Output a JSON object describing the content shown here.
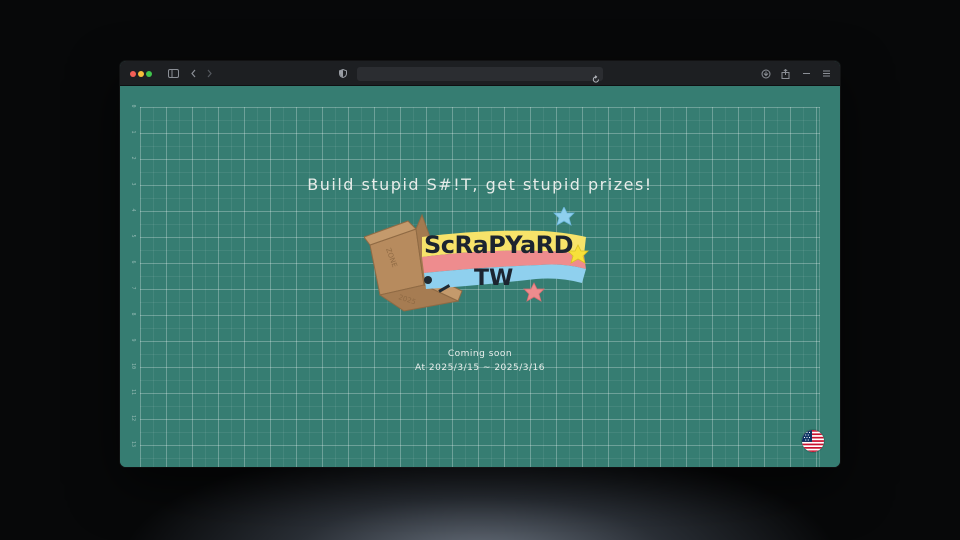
{
  "browser": {
    "address_text": "",
    "icons": [
      "sidebar-icon",
      "back-icon",
      "forward-icon",
      "shield-icon",
      "reload-icon",
      "download-icon",
      "share-icon",
      "minimize-icon",
      "menu-icon"
    ]
  },
  "ruler": {
    "labels": [
      "0",
      "1",
      "2",
      "3",
      "4",
      "5",
      "6",
      "7",
      "8",
      "9",
      "10",
      "11",
      "12",
      "13"
    ]
  },
  "hero": {
    "tagline": "Build stupid S#!T, get stupid prizes!",
    "logo_line1": "ScRaPYaRD",
    "logo_line2": "TW",
    "box_label_top": "ZONE",
    "box_label_side": "2025"
  },
  "event": {
    "status": "Coming soon",
    "dates": "At 2025/3/15 ~ 2025/3/16"
  },
  "language": {
    "flag": "us-flag-icon"
  },
  "colors": {
    "page_bg": "#367d72",
    "banner_yellow": "#f7e36a",
    "banner_pink": "#ee8c8e",
    "banner_blue": "#8fd0ee",
    "box_brown": "#b78b5e",
    "star_blue": "#8fd0ee",
    "star_yellow": "#f7e03a",
    "star_pink": "#ee8c8e"
  }
}
